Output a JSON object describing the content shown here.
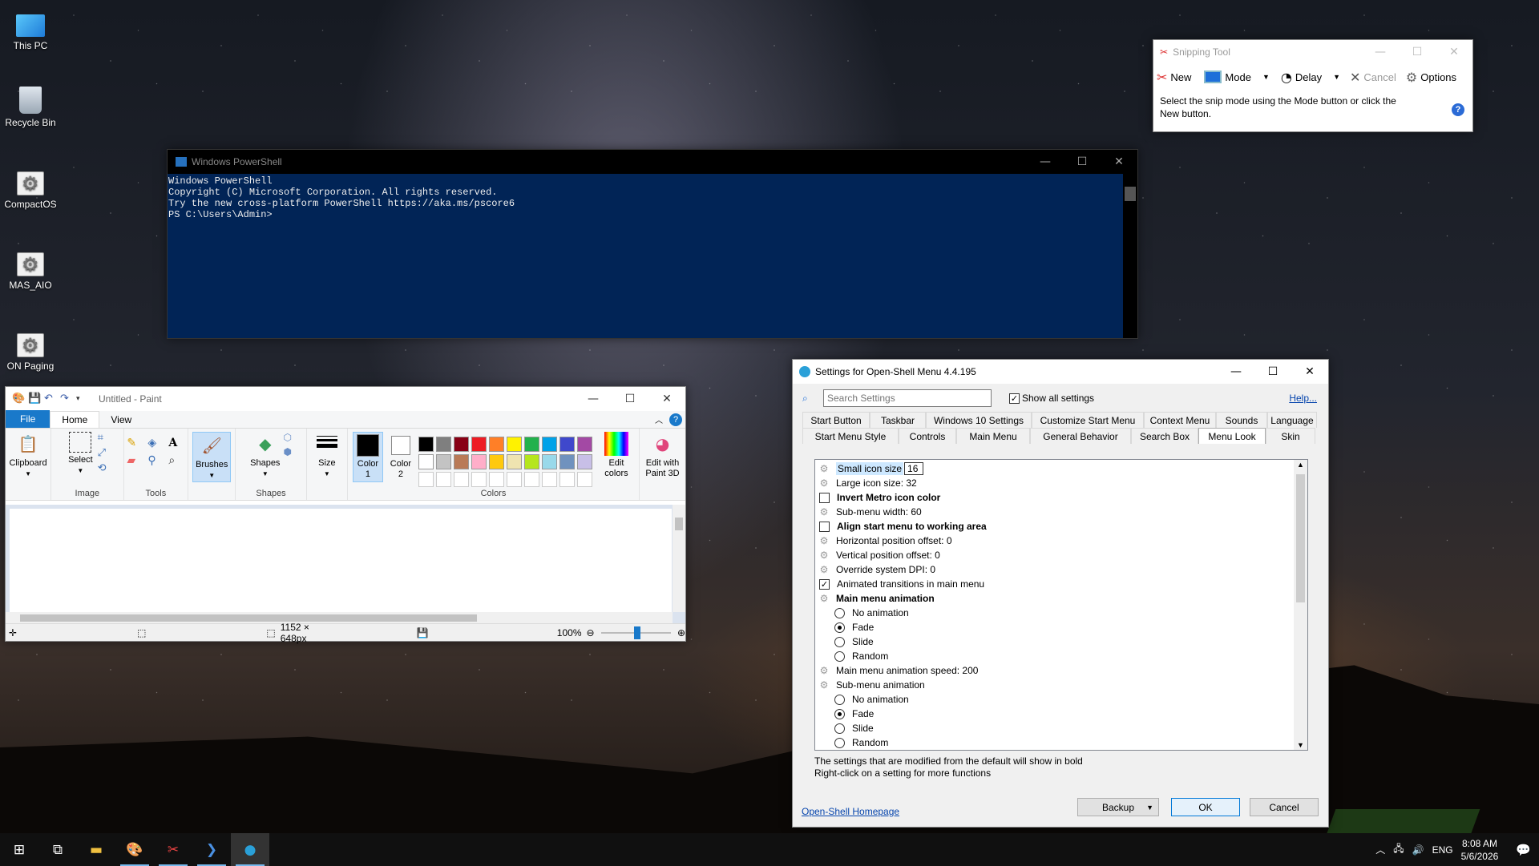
{
  "desktop": {
    "icons": [
      {
        "label": "This PC",
        "icon": "computer-icon"
      },
      {
        "label": "Recycle Bin",
        "icon": "recycle-bin-icon"
      },
      {
        "label": "CompactOS",
        "icon": "gear-shortcut-icon"
      },
      {
        "label": "MAS_AIO",
        "icon": "gear-shortcut-icon"
      },
      {
        "label": "ON Paging",
        "icon": "gear-shortcut-icon"
      }
    ]
  },
  "snipping": {
    "title": "Snipping Tool",
    "new": "New",
    "mode": "Mode",
    "delay": "Delay",
    "cancel": "Cancel",
    "options": "Options",
    "message": "Select the snip mode using the Mode button or click the New button."
  },
  "powershell": {
    "title": "Windows PowerShell",
    "lines": [
      "Windows PowerShell",
      "Copyright (C) Microsoft Corporation. All rights reserved.",
      "",
      "Try the new cross-platform PowerShell https://aka.ms/pscore6",
      "",
      "PS C:\\Users\\Admin>"
    ],
    "bg_color": "#012456"
  },
  "paint": {
    "title": "Untitled - Paint",
    "tabs": {
      "file": "File",
      "home": "Home",
      "view": "View"
    },
    "clipboard": "Clipboard",
    "select": "Select",
    "image": "Image",
    "tools": "Tools",
    "brushes": "Brushes",
    "shapes": "Shapes",
    "shapes_group": "Shapes",
    "size": "Size",
    "color1": "Color 1",
    "color2": "Color 2",
    "colors_group": "Colors",
    "edit_colors": "Edit colors",
    "paint3d": "Edit with Paint 3D",
    "palette": [
      "#000000",
      "#7f7f7f",
      "#880015",
      "#ed1c24",
      "#ff7f27",
      "#fff200",
      "#22b14c",
      "#00a2e8",
      "#3f48cc",
      "#a349a4",
      "#ffffff",
      "#c3c3c3",
      "#b97a57",
      "#ffaec9",
      "#ffc90e",
      "#efe4b0",
      "#b5e61d",
      "#99d9ea",
      "#7092be",
      "#c8bfe7"
    ],
    "dimensions": "1152 × 648px",
    "zoom": "100%",
    "zoom_level_percent": 100
  },
  "openshell": {
    "title": "Settings for Open-Shell Menu 4.4.195",
    "search_placeholder": "Search Settings",
    "show_all": "Show all settings",
    "help": "Help...",
    "tabs_row1": [
      "Start Button",
      "Taskbar",
      "Windows 10 Settings",
      "Customize Start Menu",
      "Context Menu",
      "Sounds",
      "Language"
    ],
    "tabs_row2": [
      "Start Menu Style",
      "Controls",
      "Main Menu",
      "General Behavior",
      "Search Box",
      "Menu Look",
      "Skin"
    ],
    "selected_tab": "Menu Look",
    "small_icon_label": "Small icon size",
    "small_icon_value": "16",
    "settings": [
      {
        "kind": "gear",
        "label": "Large icon size: 32",
        "bold": false
      },
      {
        "kind": "check",
        "checked": false,
        "label": "Invert Metro icon color",
        "bold": true
      },
      {
        "kind": "gear",
        "label": "Sub-menu width: 60",
        "bold": false
      },
      {
        "kind": "check",
        "checked": false,
        "label": "Align start menu to working area",
        "bold": true
      },
      {
        "kind": "gear",
        "label": "Horizontal position offset: 0",
        "bold": false
      },
      {
        "kind": "gear",
        "label": "Vertical position offset: 0",
        "bold": false
      },
      {
        "kind": "gear",
        "label": "Override system DPI: 0",
        "bold": false
      },
      {
        "kind": "check",
        "checked": true,
        "label": "Animated transitions in main menu",
        "bold": false
      },
      {
        "kind": "gear",
        "label": "Main menu animation",
        "bold": true
      },
      {
        "kind": "radio",
        "checked": false,
        "label": "No animation",
        "bold": false
      },
      {
        "kind": "radio",
        "checked": true,
        "label": "Fade",
        "bold": false
      },
      {
        "kind": "radio",
        "checked": false,
        "label": "Slide",
        "bold": false
      },
      {
        "kind": "radio",
        "checked": false,
        "label": "Random",
        "bold": false
      },
      {
        "kind": "gear",
        "label": "Main menu animation speed: 200",
        "bold": false
      },
      {
        "kind": "gear",
        "label": "Sub-menu animation",
        "bold": false
      },
      {
        "kind": "radio",
        "checked": false,
        "label": "No animation",
        "bold": false
      },
      {
        "kind": "radio",
        "checked": true,
        "label": "Fade",
        "bold": false
      },
      {
        "kind": "radio",
        "checked": false,
        "label": "Slide",
        "bold": false
      },
      {
        "kind": "radio",
        "checked": false,
        "label": "Random",
        "bold": false
      }
    ],
    "note1": "The settings that are modified from the default will show in bold",
    "note2": "Right-click on a setting for more functions",
    "homepage": "Open-Shell Homepage",
    "backup": "Backup",
    "ok": "OK",
    "cancel": "Cancel"
  },
  "taskbar": {
    "lang": "ENG",
    "time": "8:08 AM",
    "date": "5/6/2026"
  }
}
